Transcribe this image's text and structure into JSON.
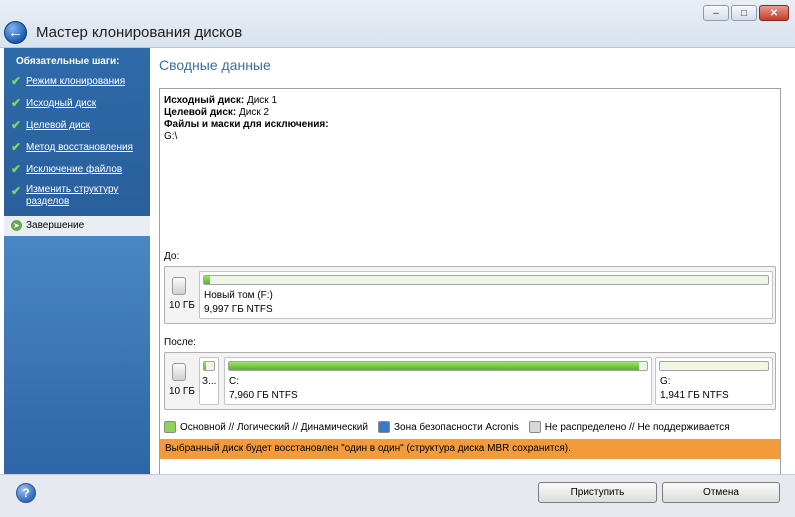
{
  "window": {
    "title": "Мастер клонирования дисков",
    "back_icon": "back-arrow-icon",
    "controls": [
      "minimize",
      "maximize",
      "close"
    ]
  },
  "sidebar": {
    "heading": "Обязательные шаги:",
    "items": [
      {
        "label": "Режим клонирования",
        "done": true
      },
      {
        "label": "Исходный диск",
        "done": true
      },
      {
        "label": "Целевой диск",
        "done": true
      },
      {
        "label": "Метод восстановления",
        "done": true
      },
      {
        "label": "Исключение файлов",
        "done": true
      },
      {
        "label": "Изменить структуру разделов",
        "done": true
      }
    ],
    "active_item": {
      "label": "Завершение"
    }
  },
  "main": {
    "title": "Сводные данные",
    "summary": {
      "source_label": "Исходный диск:",
      "source_value": "Диск 1",
      "target_label": "Целевой диск:",
      "target_value": "Диск 2",
      "exclude_label": "Файлы и маски для исключения:",
      "exclude_value": "G:\\"
    },
    "before": {
      "label": "До:",
      "disk_size": "10 ГБ",
      "partitions": [
        {
          "name": "Новый том (F:)",
          "size": "9,997 ГБ  NTFS",
          "usage_fraction": 0.01
        }
      ]
    },
    "after": {
      "label": "После:",
      "disk_size": "10 ГБ",
      "partitions": [
        {
          "name": "З...",
          "size": "",
          "usage_fraction": 0.2
        },
        {
          "name": "C:",
          "size": "7,960 ГБ  NTFS",
          "usage_fraction": 0.98
        },
        {
          "name": "G:",
          "size": "1,941 ГБ  NTFS",
          "usage_fraction": 0.0
        }
      ]
    },
    "legend": [
      {
        "label": "Основной // Логический // Динамический",
        "color": "#8fd45a"
      },
      {
        "label": "Зона безопасности Acronis",
        "color": "#3a78c8"
      },
      {
        "label": "Не распределено // Не поддерживается",
        "color": "#d8d8d8"
      }
    ],
    "notice": "Выбранный диск будет восстановлен \"один в один\" (структура диска MBR сохранится)."
  },
  "footer": {
    "help_icon": "help-icon",
    "proceed_label": "Приступить",
    "cancel_label": "Отмена"
  },
  "colors": {
    "accent": "#3a6ea5",
    "sidebar": "#2f6aa8",
    "notice": "#f39a3a",
    "partition_fill": "#55b32a"
  }
}
